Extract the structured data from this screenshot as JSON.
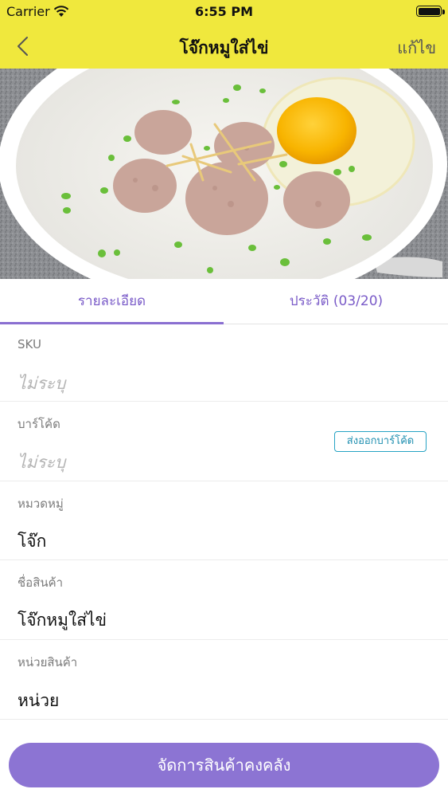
{
  "status_bar": {
    "carrier": "Carrier",
    "time": "6:55 PM"
  },
  "nav": {
    "title": "โจ๊กหมูใส่ไข่",
    "edit_label": "แก้ไข"
  },
  "tabs": [
    {
      "label": "รายละเอียด",
      "active": true
    },
    {
      "label": "ประวัติ (03/20)",
      "active": false
    }
  ],
  "fields": {
    "sku": {
      "label": "SKU",
      "value": "ไม่ระบุ"
    },
    "barcode": {
      "label": "บาร์โค้ด",
      "value": "ไม่ระบุ",
      "export_label": "ส่งออกบาร์โค้ด"
    },
    "category": {
      "label": "หมวดหมู่",
      "value": "โจ๊ก"
    },
    "product_name": {
      "label": "ชื่อสินค้า",
      "value": "โจ๊กหมูใส่ไข่"
    },
    "unit": {
      "label": "หน่วยสินค้า",
      "value": "หน่วย"
    }
  },
  "bottom_button": {
    "label": "จัดการสินค้าคงคลัง"
  },
  "colors": {
    "header_bg": "#f0e83d",
    "accent_purple": "#8c74d3",
    "export_blue": "#27a3c4"
  }
}
